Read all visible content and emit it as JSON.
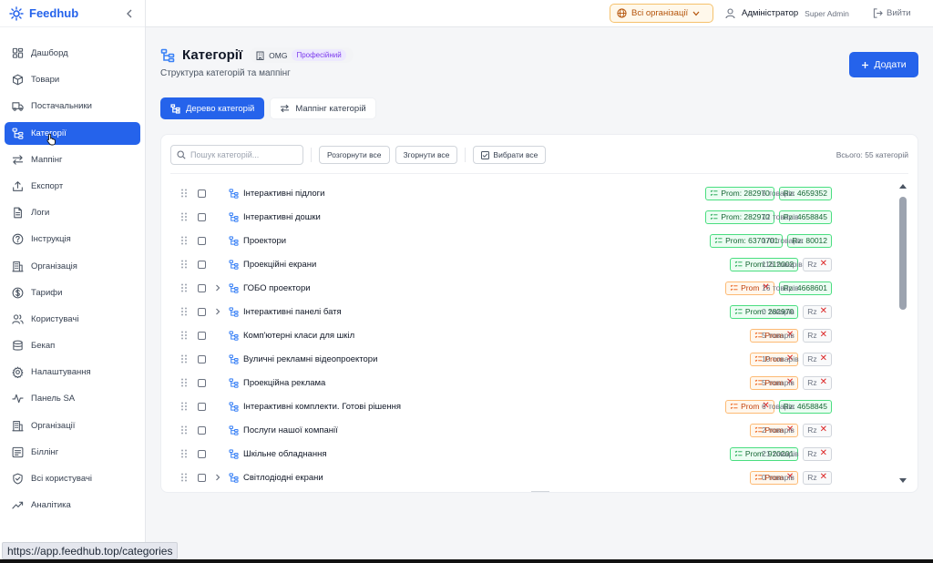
{
  "brand": {
    "name": "Feedhub"
  },
  "sidebar": {
    "items": [
      {
        "label": "Дашборд",
        "icon": "dashboard-icon"
      },
      {
        "label": "Товари",
        "icon": "box-icon"
      },
      {
        "label": "Постачальники",
        "icon": "truck-icon"
      },
      {
        "label": "Категорії",
        "icon": "tree-icon",
        "active": true
      },
      {
        "label": "Маппінг",
        "icon": "arrows-icon"
      },
      {
        "label": "Експорт",
        "icon": "upload-icon"
      },
      {
        "label": "Логи",
        "icon": "file-icon"
      },
      {
        "label": "Інструкція",
        "icon": "help-icon"
      },
      {
        "label": "Організація",
        "icon": "building-icon"
      },
      {
        "label": "Тарифи",
        "icon": "dollar-icon"
      },
      {
        "label": "Користувачі",
        "icon": "users-icon"
      },
      {
        "label": "Бекап",
        "icon": "database-icon"
      },
      {
        "label": "Налаштування",
        "icon": "gear-icon"
      },
      {
        "label": "Панель SA",
        "icon": "activity-icon"
      },
      {
        "label": "Організації",
        "icon": "building-icon"
      },
      {
        "label": "Біллінг",
        "icon": "card-icon"
      },
      {
        "label": "Всі користувачі",
        "icon": "shield-icon"
      },
      {
        "label": "Аналітика",
        "icon": "trend-icon"
      }
    ]
  },
  "topbar": {
    "org_selector": "Всі організації",
    "user_name": "Адміністратор",
    "user_role": "Super Admin",
    "logout": "Вийти"
  },
  "header": {
    "title": "Категорії",
    "org": "OMG",
    "plan": "Професійний",
    "subtitle": "Структура категорій та маппінг",
    "add_button": "Додати"
  },
  "tabs": [
    {
      "label": "Дерево категорій",
      "active": true
    },
    {
      "label": "Маппінг категорій",
      "active": false
    }
  ],
  "toolbar": {
    "search_placeholder": "Пошук категорій...",
    "expand_all": "Розгорнути все",
    "collapse_all": "Згорнути все",
    "select_all": "Вибрати все",
    "total": "Всього: 55 категорій"
  },
  "categories": [
    {
      "name": "Інтерактивні підлоги",
      "expandable": false,
      "prom": "Prom: 282970",
      "rz": "Rz: 4659352",
      "count": "5 товарів"
    },
    {
      "name": "Інтерактивні дошки",
      "expandable": false,
      "prom": "Prom: 282970",
      "rz": "Rz: 4658845",
      "count": "12 товарів"
    },
    {
      "name": "Проектори",
      "expandable": false,
      "prom": "Prom: 6370701",
      "rz": "Rz: 80012",
      "count": "170 товарів"
    },
    {
      "name": "Проекційні екрани",
      "expandable": false,
      "prom": "Prom: 212003",
      "rz": null,
      "count": "116 товарів"
    },
    {
      "name": "ГОБО проектори",
      "expandable": true,
      "prom": null,
      "rz": "Rz: 4668601",
      "count": "16 товарів"
    },
    {
      "name": "Інтерактивні панелі батя",
      "expandable": true,
      "prom": "Prom: 282970",
      "rz": null,
      "count": "0 товарів"
    },
    {
      "name": "Комп'ютерні класи для шкіл",
      "expandable": false,
      "prom": null,
      "rz": null,
      "count": "5 товарів"
    },
    {
      "name": "Вуличні рекламні відеопроектори",
      "expandable": false,
      "prom": null,
      "rz": null,
      "count": "10 товарів"
    },
    {
      "name": "Проекційна реклама",
      "expandable": false,
      "prom": null,
      "rz": null,
      "count": "5 товарів"
    },
    {
      "name": "Інтерактивні комплекти. Готові рішення",
      "expandable": false,
      "prom": null,
      "rz": "Rz: 4658845",
      "count": "6 товарів"
    },
    {
      "name": "Послуги нашої компанії",
      "expandable": false,
      "prom": null,
      "rz": null,
      "count": "2 товарів"
    },
    {
      "name": "Шкільне обладнання",
      "expandable": false,
      "prom": "Prom: 920201",
      "rz": null,
      "count": "21 товарів"
    },
    {
      "name": "Світлодіодні екрани",
      "expandable": true,
      "prom": null,
      "rz": null,
      "count": "0 товарів"
    }
  ],
  "labels": {
    "prom_missing": "Prom",
    "rz_missing": "Rz"
  },
  "status_url": "https://app.feedhub.top/categories",
  "colors": {
    "accent": "#2563eb",
    "ok": "#166534",
    "warn": "#c2410c",
    "error": "#dc2626"
  }
}
